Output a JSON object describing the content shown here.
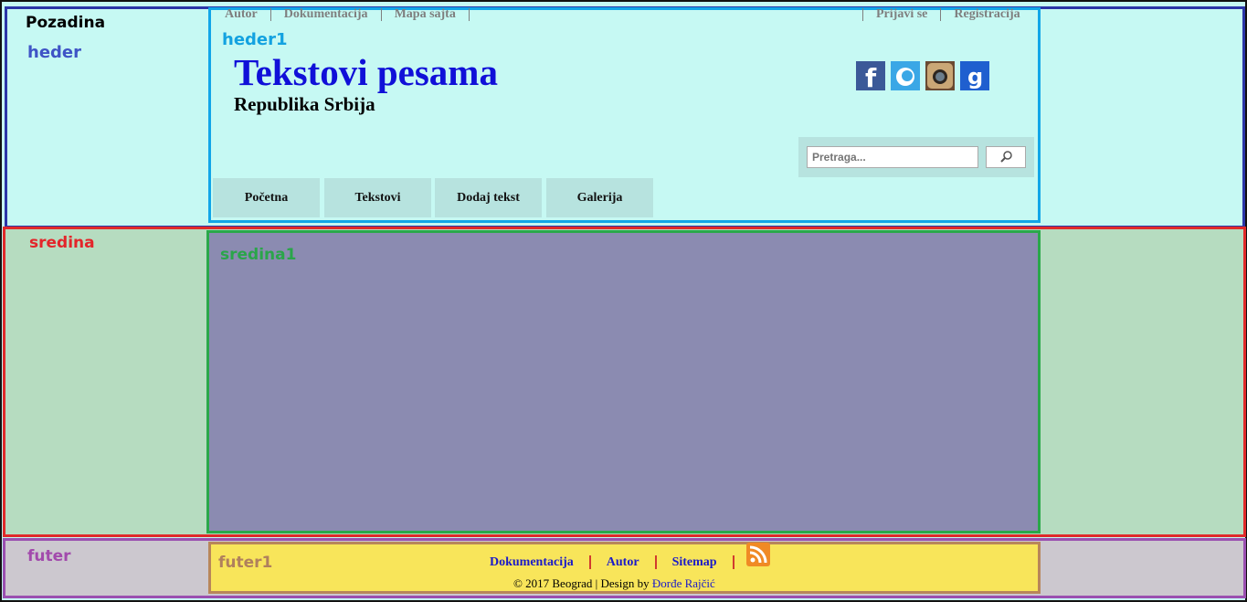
{
  "labels": {
    "pozadina": "Pozadina",
    "heder": "heder",
    "heder1": "heder1",
    "sredina": "sredina",
    "sredina1": "sredina1",
    "futer": "futer",
    "futer1": "futer1"
  },
  "top_nav_left": [
    "Autor",
    "Dokumentacija",
    "Mapa sajta"
  ],
  "top_nav_right": [
    "Prijavi se",
    "Registracija"
  ],
  "site": {
    "title": "Tekstovi pesama",
    "subtitle": "Republika Srbija"
  },
  "social_icons": [
    "facebook-icon",
    "twitter-icon",
    "instagram-icon",
    "google-icon"
  ],
  "search": {
    "placeholder": "Pretraga...",
    "button_icon": "search-icon"
  },
  "main_nav": [
    "Početna",
    "Tekstovi",
    "Dodaj tekst",
    "Galerija"
  ],
  "footer": {
    "nav": [
      "Dokumentacija",
      "Autor",
      "Sitemap"
    ],
    "rss_icon": "rss-icon",
    "copyright_prefix": "© 2017 Beograd | Design by ",
    "author": "Đorđe Rajčić"
  },
  "colors": {
    "header_bg": "#c6f9f3",
    "middle_bg": "#b6dcc0",
    "middle_inner_bg": "#8b8bb1",
    "footer_bg": "#ccc8cf",
    "footer_inner_bg": "#f8e55a",
    "title_color": "#1010d8"
  }
}
